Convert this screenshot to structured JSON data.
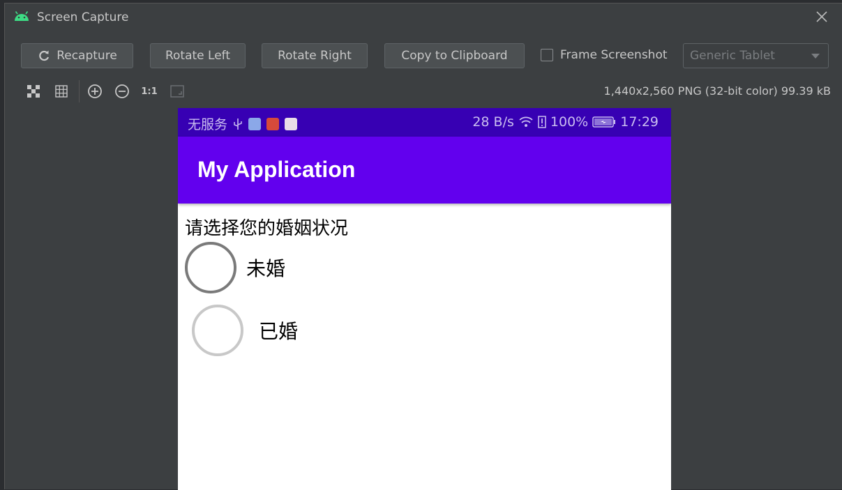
{
  "window": {
    "title": "Screen Capture"
  },
  "toolbar": {
    "recapture": "Recapture",
    "rotate_left": "Rotate Left",
    "rotate_right": "Rotate Right",
    "copy": "Copy to Clipboard",
    "frame_screenshot": "Frame Screenshot",
    "frame_checked": false,
    "device_select": "Generic Tablet"
  },
  "viewtools": {
    "actual_size_label": "1:1",
    "image_info": "1,440x2,560 PNG (32-bit color) 99.39 kB"
  },
  "device": {
    "status_bar": {
      "carrier": "无服务",
      "speed": "28 B/s",
      "battery": "100%",
      "time": "17:29"
    },
    "app_title": "My Application",
    "question": "请选择您的婚姻状况",
    "options": [
      {
        "label": "未婚",
        "selected": false
      },
      {
        "label": "已婚",
        "selected": false
      }
    ]
  },
  "colors": {
    "status_bar": "#3700b3",
    "app_bar": "#6200ee",
    "ide_bg": "#3c3f41"
  }
}
